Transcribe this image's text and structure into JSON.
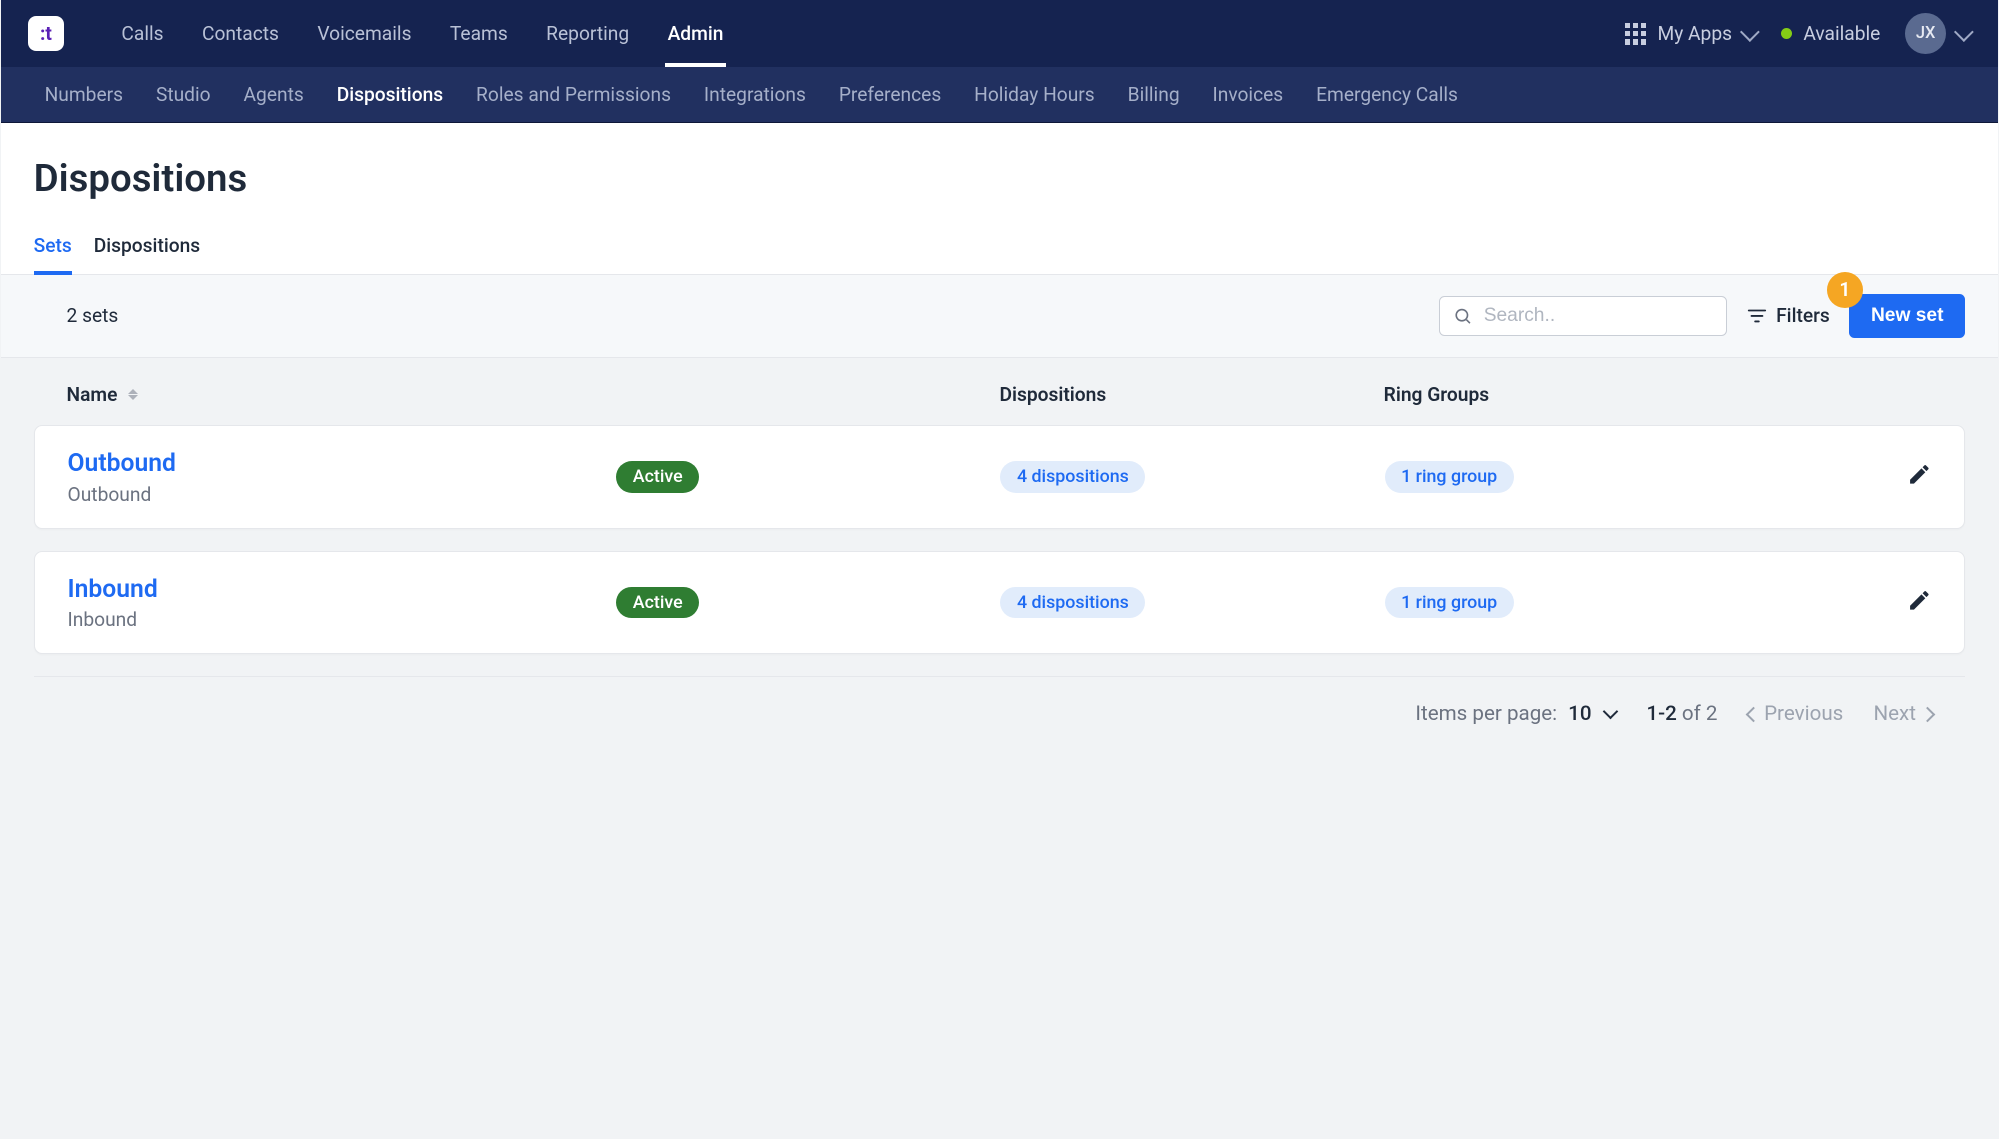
{
  "topnav": {
    "my_apps": "My Apps",
    "status_label": "Available",
    "avatar_initials": "JX",
    "items": [
      {
        "label": "Calls"
      },
      {
        "label": "Contacts"
      },
      {
        "label": "Voicemails"
      },
      {
        "label": "Teams"
      },
      {
        "label": "Reporting"
      },
      {
        "label": "Admin",
        "active": true
      }
    ]
  },
  "subnav": {
    "items": [
      {
        "label": "Numbers"
      },
      {
        "label": "Studio"
      },
      {
        "label": "Agents"
      },
      {
        "label": "Dispositions",
        "active": true
      },
      {
        "label": "Roles and Permissions"
      },
      {
        "label": "Integrations"
      },
      {
        "label": "Preferences"
      },
      {
        "label": "Holiday Hours"
      },
      {
        "label": "Billing"
      },
      {
        "label": "Invoices"
      },
      {
        "label": "Emergency Calls"
      }
    ]
  },
  "page": {
    "title": "Dispositions"
  },
  "tabs": [
    {
      "label": "Sets",
      "active": true
    },
    {
      "label": "Dispositions"
    }
  ],
  "toolbar": {
    "count_label": "2 sets",
    "search_placeholder": "Search..",
    "filters_label": "Filters",
    "new_set_label": "New set",
    "step_badge": "1"
  },
  "table": {
    "columns": {
      "name": "Name",
      "dispositions": "Dispositions",
      "ring_groups": "Ring Groups"
    },
    "rows": [
      {
        "title": "Outbound",
        "subtitle": "Outbound",
        "status": "Active",
        "dispositions": "4 dispositions",
        "ring_groups": "1 ring group"
      },
      {
        "title": "Inbound",
        "subtitle": "Inbound",
        "status": "Active",
        "dispositions": "4 dispositions",
        "ring_groups": "1 ring group"
      }
    ]
  },
  "pagination": {
    "items_per_page_label": "Items per page:",
    "page_size": "10",
    "range": "1-2",
    "of_label": "of",
    "total": "2",
    "previous_label": "Previous",
    "next_label": "Next"
  }
}
